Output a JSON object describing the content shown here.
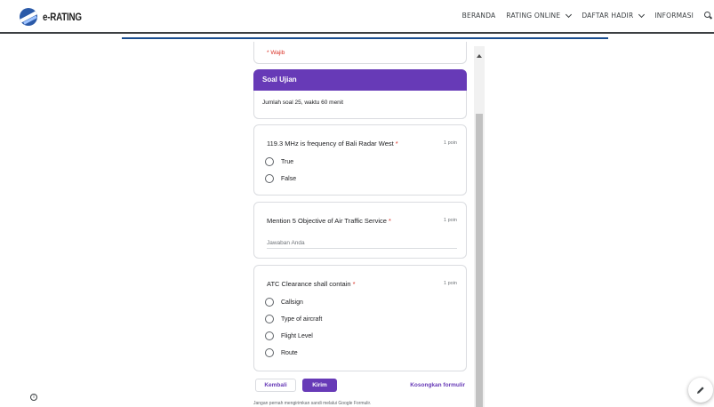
{
  "header": {
    "brand": "e-RATING",
    "nav": [
      {
        "label": "BERANDA",
        "dropdown": false
      },
      {
        "label": "RATING ONLINE",
        "dropdown": true
      },
      {
        "label": "DAFTAR HADIR",
        "dropdown": true
      },
      {
        "label": "INFORMASI",
        "dropdown": false
      }
    ],
    "search_icon": "search-icon"
  },
  "form": {
    "required_note": "* Wajib",
    "section": {
      "title": "Soal Ujian",
      "description": "Jumlah soal 25, waktu 60 menit"
    },
    "questions": [
      {
        "title": "119.3 MHz is frequency of Bali Radar West",
        "required_mark": "*",
        "points": "1 poin",
        "options": [
          "True",
          "False"
        ]
      },
      {
        "title": "Mention 5 Objective of Air Traffic Service",
        "required_mark": "*",
        "points": "1 poin",
        "placeholder": "Jawaban Anda"
      },
      {
        "title": "ATC Clearance shall contain",
        "required_mark": "*",
        "points": "1 poin",
        "options": [
          "Callsign",
          "Type of aircraft",
          "Flight Level",
          "Route"
        ]
      }
    ],
    "buttons": {
      "back": "Kembali",
      "submit": "Kirim",
      "clear": "Kosongkan formulir"
    },
    "footer": "Jangan pernah mengirimkan sandi melalui Google Formulir."
  },
  "colors": {
    "accent": "#673ab7",
    "required": "#d93025",
    "brand_blue": "#1a4d8f"
  },
  "icons": {
    "info": "info-icon",
    "edit": "edit-pencil-icon"
  }
}
